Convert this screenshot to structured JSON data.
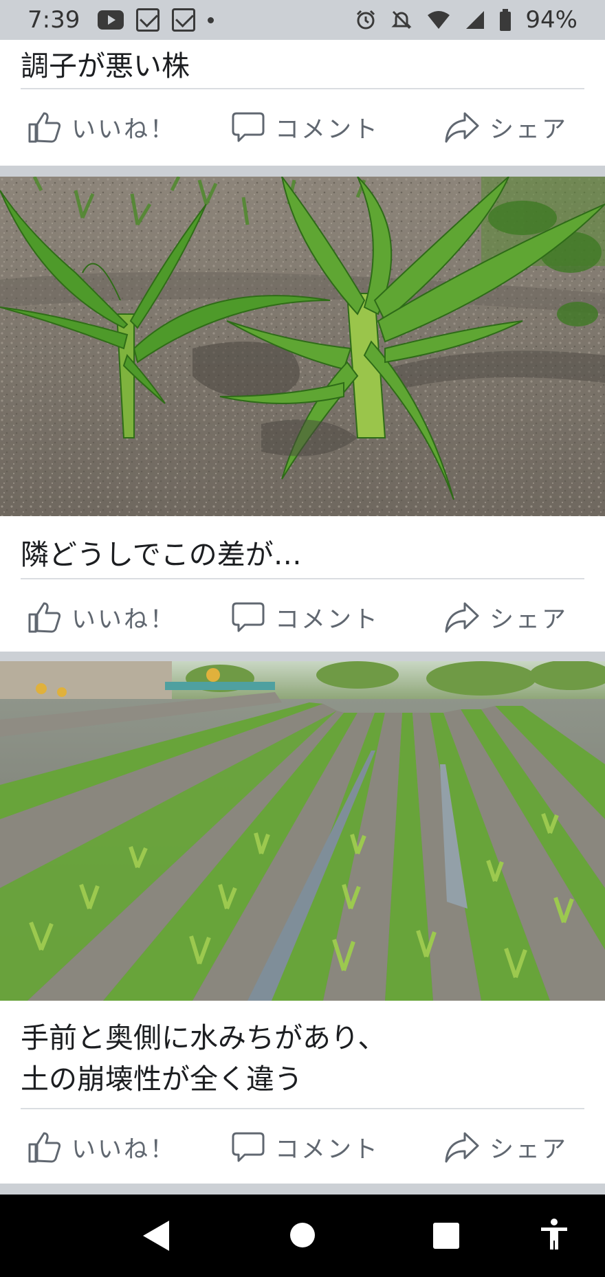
{
  "status_bar": {
    "time": "7:39",
    "battery": "94%",
    "icons": [
      "youtube-icon",
      "mail-icon",
      "mail-icon",
      "dot-icon",
      "alarm-icon",
      "mute-icon",
      "wifi-icon",
      "signal-icon",
      "battery-icon"
    ]
  },
  "posts": [
    {
      "caption": "調子が悪い株"
    },
    {
      "caption": "隣どうしでこの差が…"
    },
    {
      "caption_lines": [
        "手前と奥側に水みちがあり、",
        "土の崩壊性が全く違う"
      ]
    }
  ],
  "actions": {
    "like": "いいね！",
    "comment": "コメント",
    "share": "シェア"
  },
  "colors": {
    "separator": "#ccd0d5",
    "action_text": "#606770",
    "caption_text": "#1c1e21"
  },
  "navigation": [
    "back-icon",
    "home-icon",
    "recents-icon",
    "accessibility-icon"
  ]
}
